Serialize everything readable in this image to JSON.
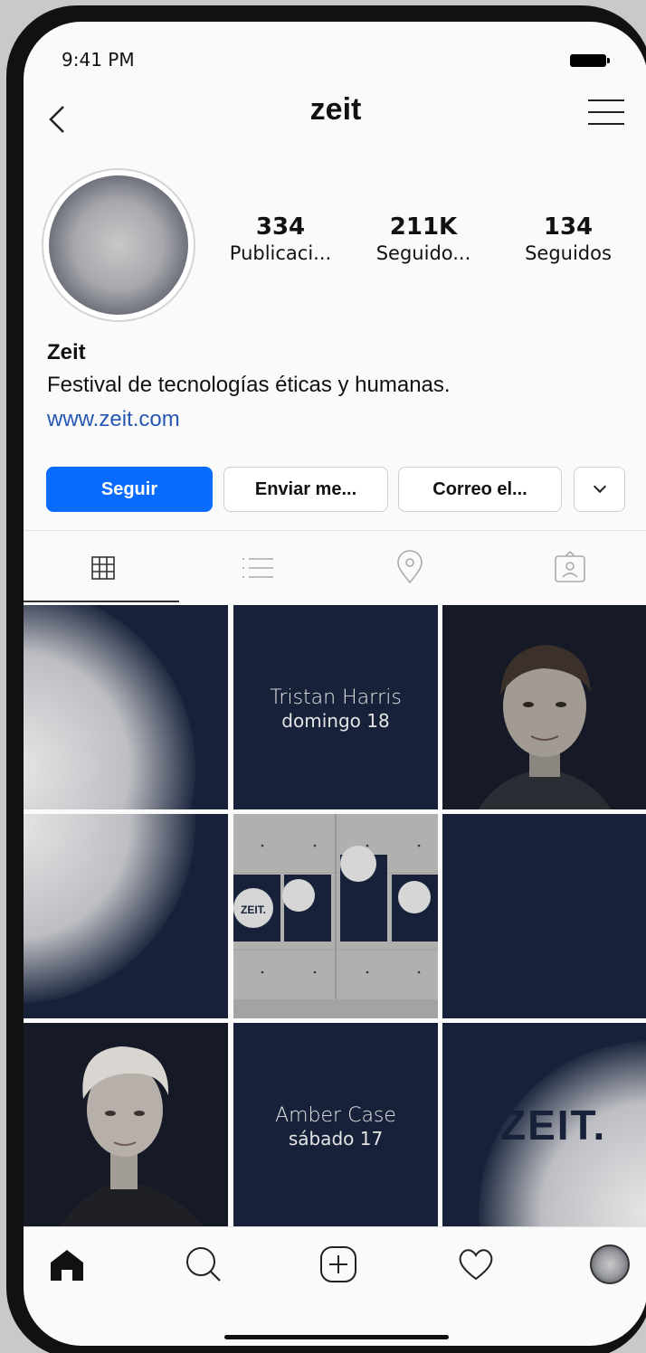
{
  "status_bar": {
    "time": "9:41 PM"
  },
  "header": {
    "username": "zeit"
  },
  "profile": {
    "stats": [
      {
        "value": "334",
        "label": "Publicaci..."
      },
      {
        "value": "211K",
        "label": "Seguido..."
      },
      {
        "value": "134",
        "label": "Seguidos"
      }
    ],
    "name": "Zeit",
    "bio": "Festival de tecnologías éticas y humanas.",
    "link": "www.zeit.com"
  },
  "actions": {
    "follow": "Seguir",
    "message": "Enviar me...",
    "email": "Correo el..."
  },
  "tabs": [
    "grid-icon",
    "list-icon",
    "location-icon",
    "tagged-icon"
  ],
  "posts": {
    "tile2_title": "Tristan Harris",
    "tile2_sub": "domingo 18",
    "tile8_title": "Amber Case",
    "tile8_sub": "sábado 17",
    "tile9_text": "ZEIT.",
    "tile5_poster_text": "ZEIT."
  },
  "bottom_nav": [
    "home-icon",
    "search-icon",
    "add-post-icon",
    "heart-icon",
    "profile-avatar-icon"
  ],
  "colors": {
    "accent": "#0a6cff",
    "link": "#2557b3",
    "tile_dark": "#17223a"
  }
}
